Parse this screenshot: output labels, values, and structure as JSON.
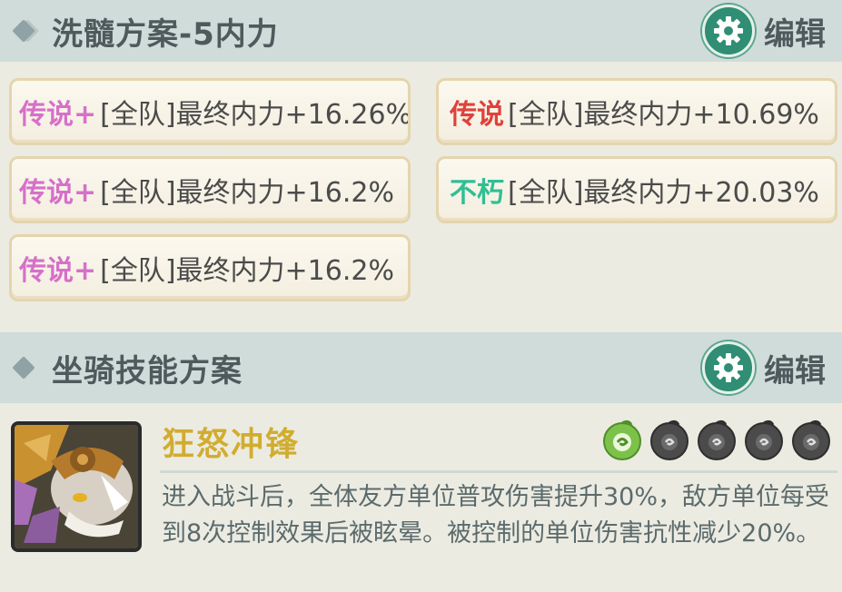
{
  "refine_section": {
    "title": "洗髓方案-5内力",
    "edit_label": "编辑",
    "items": [
      {
        "tier": "传说+",
        "stat": "[全队]最终内力+16.26%",
        "tier_color": "#d670c9"
      },
      {
        "tier": "传说",
        "stat": "[全队]最终内力+10.69%",
        "tier_color": "#e0413b"
      },
      {
        "tier": "传说+",
        "stat": "[全队]最终内力+16.2%",
        "tier_color": "#d670c9"
      },
      {
        "tier": "不朽",
        "stat": "[全队]最终内力+20.03%",
        "tier_color": "#2fbf93"
      },
      {
        "tier": "传说+",
        "stat": "[全队]最终内力+16.2%",
        "tier_color": "#d670c9"
      }
    ]
  },
  "mount_section": {
    "title": "坐骑技能方案",
    "edit_label": "编辑",
    "skill": {
      "name": "狂怒冲锋",
      "level_active": 1,
      "level_max": 5,
      "description": "进入战斗后，全体友方单位普攻伤害提升30%，敌方单位每受到8次控制效果后被眩晕。被控制的单位伤害抗性减少20%。"
    }
  },
  "colors": {
    "header_bg": "#cfdcda",
    "page_bg": "#ecebe2",
    "accent_green": "#2f8e74",
    "skill_name": "#d1ad2f"
  },
  "icons": {
    "section_marker": "diamond-icon",
    "edit": "gear-icon",
    "level_active": "green-swirl-icon",
    "level_locked": "gray-swirl-icon"
  }
}
